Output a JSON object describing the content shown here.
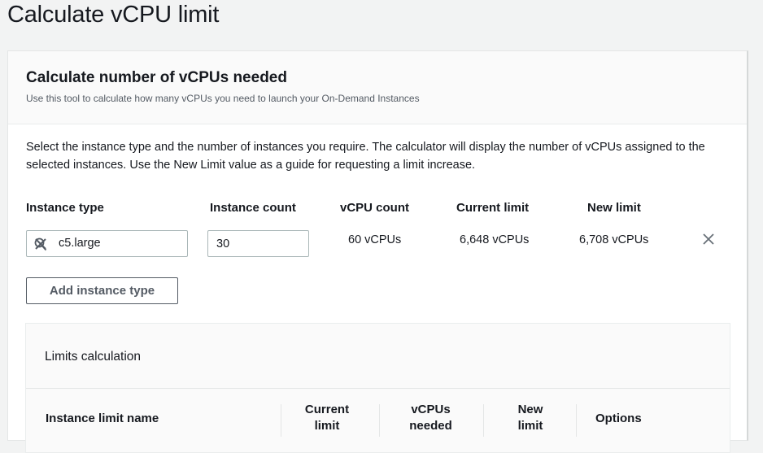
{
  "page": {
    "title": "Calculate vCPU limit"
  },
  "card": {
    "title": "Calculate number of vCPUs needed",
    "subtitle": "Use this tool to calculate how many vCPUs you need to launch your On-Demand Instances",
    "description": "Select the instance type and the number of instances you require. The calculator will display the number of vCPUs assigned to the selected instances. Use the New Limit value as a guide for requesting a limit increase."
  },
  "columns": {
    "instance_type": "Instance type",
    "instance_count": "Instance count",
    "vcpu_count": "vCPU count",
    "current_limit": "Current limit",
    "new_limit": "New limit"
  },
  "row": {
    "instance_type": "c5.large",
    "instance_count": "30",
    "vcpu_count": "60 vCPUs",
    "current_limit": "6,648 vCPUs",
    "new_limit": "6,708 vCPUs"
  },
  "add_button": "Add instance type",
  "limits": {
    "title": "Limits calculation",
    "headers": [
      "Instance limit name",
      "Current limit",
      "vCPUs needed",
      "New limit",
      "Options"
    ]
  },
  "icons": {
    "search": "search-icon",
    "clear": "close-icon",
    "remove": "close-icon"
  }
}
